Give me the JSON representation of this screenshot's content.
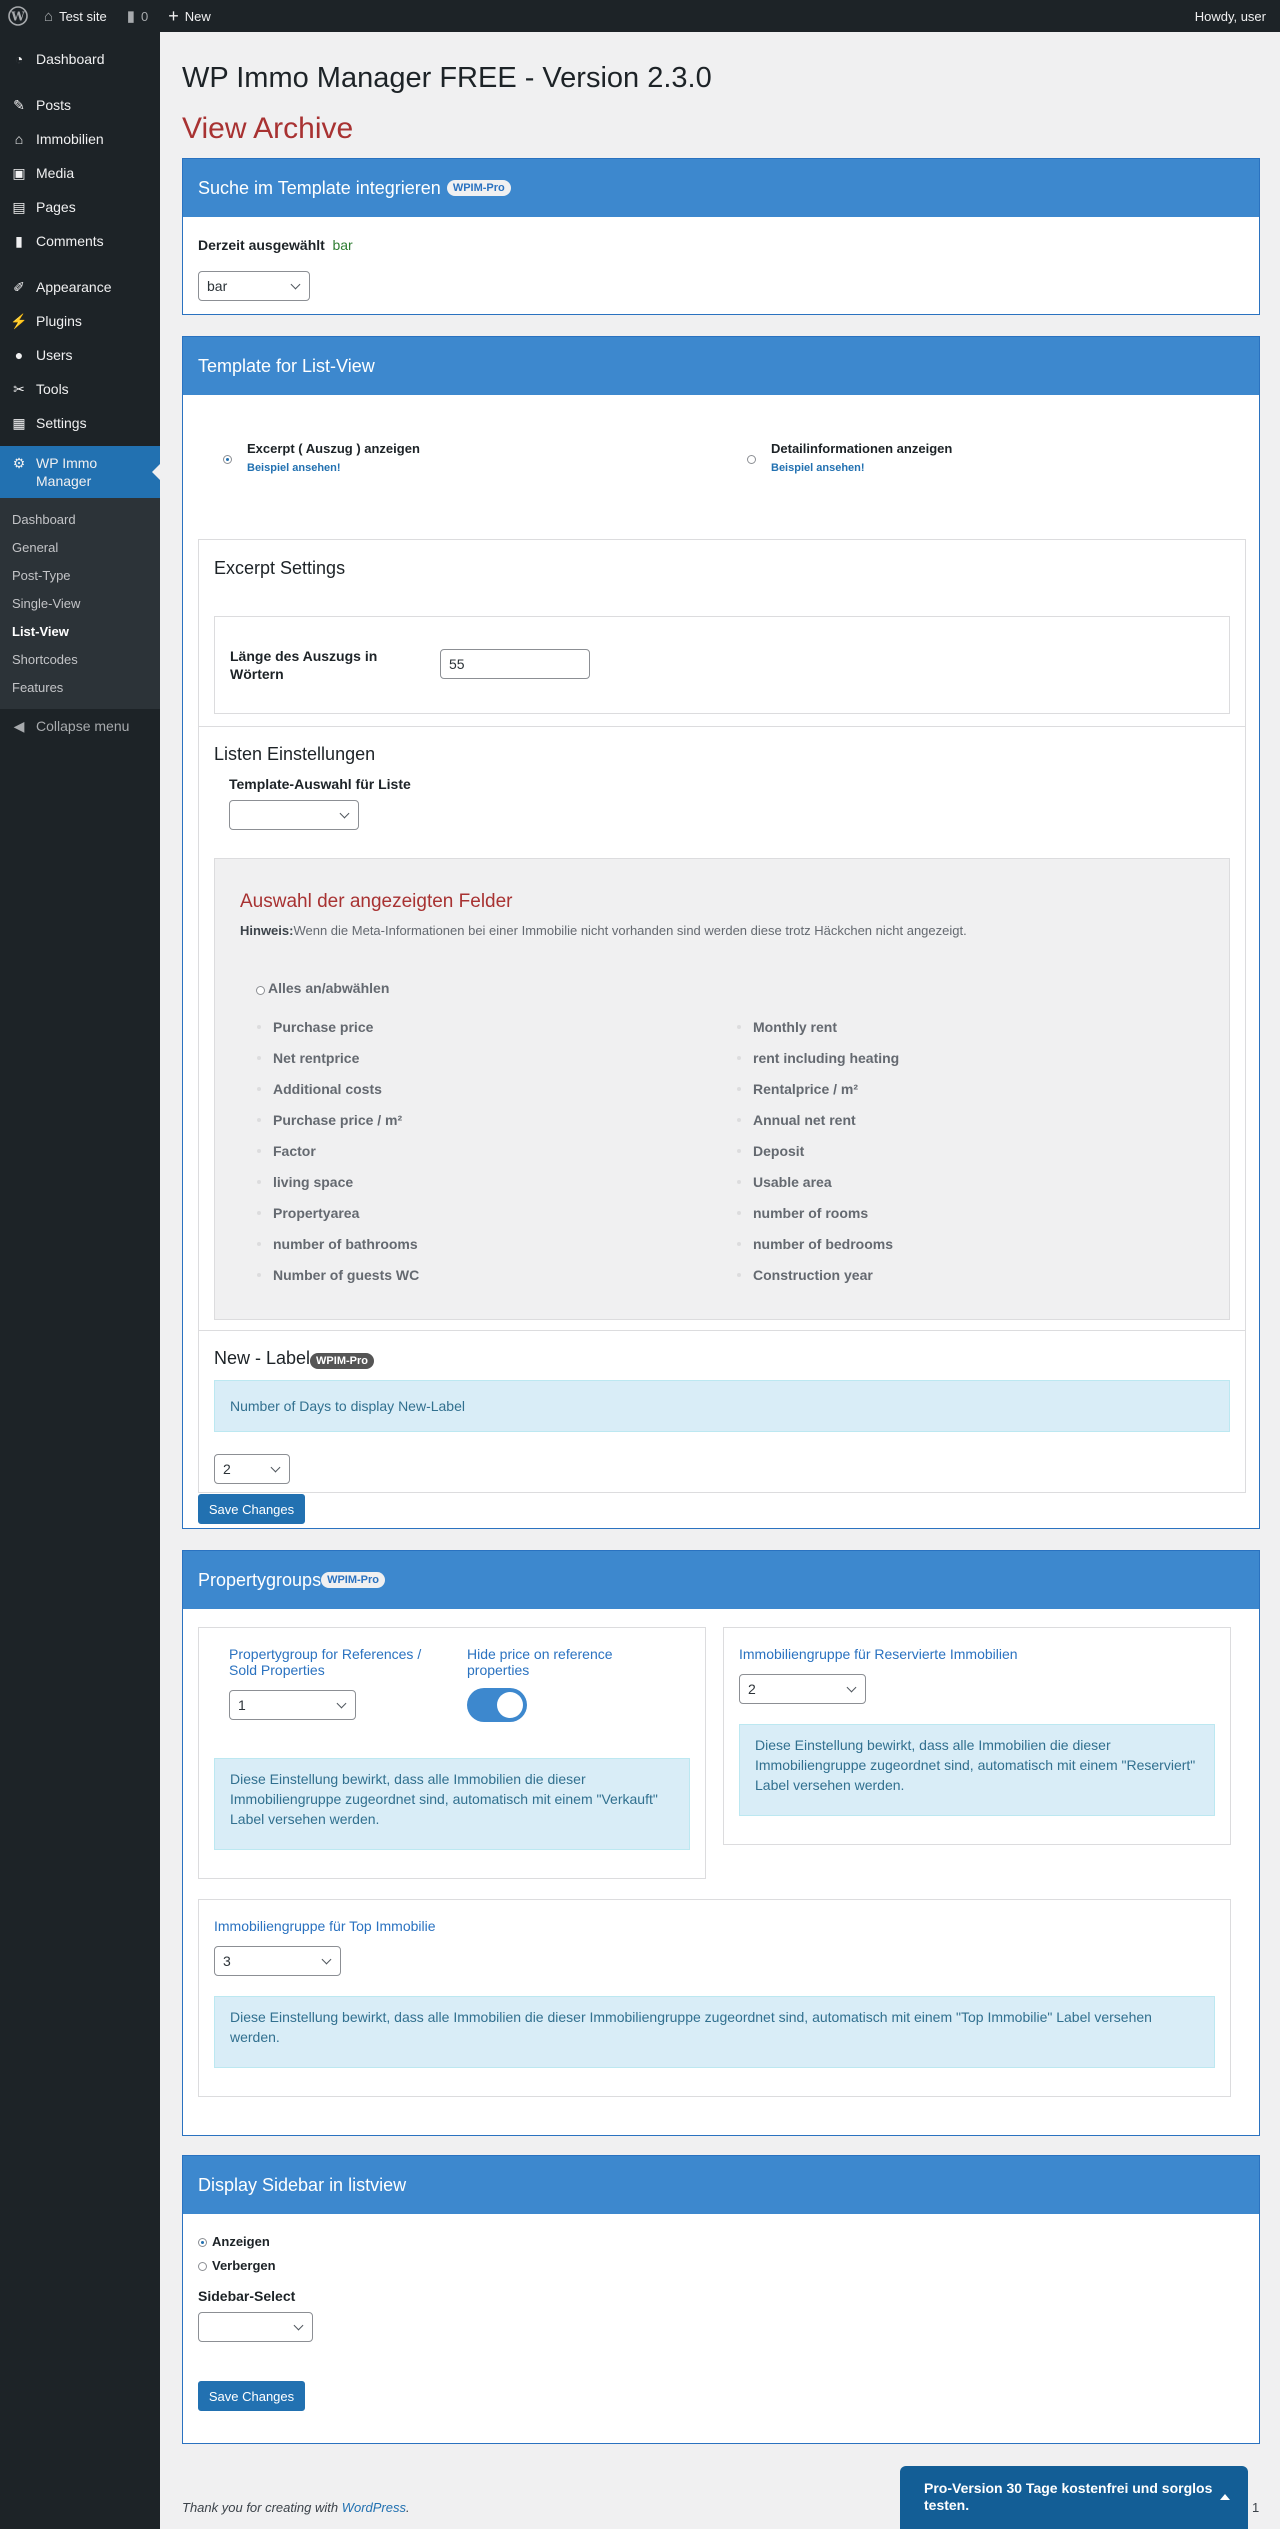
{
  "adminbar": {
    "site": "Test site",
    "comments": "0",
    "new": "New",
    "howdy": "Howdy, user"
  },
  "menu": {
    "items": [
      "Dashboard",
      "Posts",
      "Immobilien",
      "Media",
      "Pages",
      "Comments",
      "Appearance",
      "Plugins",
      "Users",
      "Tools",
      "Settings"
    ],
    "active": "WP Immo Manager",
    "sub": [
      "Dashboard",
      "General",
      "Post-Type",
      "Single-View",
      "List-View",
      "Shortcodes",
      "Features"
    ],
    "collapse": "Collapse menu"
  },
  "page": {
    "title": "WP Immo Manager FREE - Version 2.3.0",
    "subtitle": "View Archive"
  },
  "search_box": {
    "title": "Suche im Template integrieren",
    "badge": "WPIM-Pro",
    "current_label": "Derzeit ausgewählt",
    "current_value": "bar",
    "select_value": "bar"
  },
  "list_template": {
    "title": "Template for List-View",
    "opt1": "Excerpt ( Auszug ) anzeigen",
    "opt1_link": "Beispiel ansehen!",
    "opt2": "Detailinformationen anzeigen",
    "opt2_link": "Beispiel ansehen!",
    "excerpt_title": "Excerpt Settings",
    "excerpt_len_label": "Länge des Auszugs in Wörtern",
    "excerpt_len_value": "55",
    "list_title": "Listen Einstellungen",
    "template_select_label": "Template-Auswahl für Liste",
    "fields_title": "Auswahl der angezeigten Felder",
    "hint_label": "Hinweis:",
    "hint_text": "Wenn die Meta-Informationen bei einer Immobilie nicht vorhanden sind werden diese trotz Häckchen nicht angezeigt.",
    "select_all": "Alles an/abwählen",
    "fields_left": [
      "Purchase price",
      "Net rentprice",
      "Additional costs",
      "Purchase price / m²",
      "Factor",
      "living space",
      "Propertyarea",
      "number of bathrooms",
      "Number of guests WC"
    ],
    "fields_right": [
      "Monthly rent",
      "rent including heating",
      "Rentalprice / m²",
      "Annual net rent",
      "Deposit",
      "Usable area",
      "number of rooms",
      "number of bedrooms",
      "Construction year"
    ],
    "newlabel_title": "New - Label",
    "newlabel_badge": "WPIM-Pro",
    "newlabel_info": "Number of Days to display New-Label",
    "newlabel_value": "2",
    "save": "Save Changes"
  },
  "propertygroups": {
    "title": "Propertygroups",
    "badge": "WPIM-Pro",
    "ref_label": "Propertygroup for References / Sold Properties",
    "ref_value": "1",
    "hide_label": "Hide price on reference properties",
    "ref_info": "Diese Einstellung bewirkt, dass alle Immobilien die dieser Immobiliengruppe zugeordnet sind, automatisch mit einem \"Verkauft\" Label versehen werden.",
    "res_label": "Immobiliengruppe für Reservierte Immobilien",
    "res_value": "2",
    "res_info": "Diese Einstellung bewirkt, dass alle Immobilien die dieser Immobiliengruppe zugeordnet sind, automatisch mit einem \"Reserviert\" Label versehen werden.",
    "top_label": "Immobiliengruppe für Top Immobilie",
    "top_value": "3",
    "top_info": "Diese Einstellung bewirkt, dass alle Immobilien die dieser Immobiliengruppe zugeordnet sind, automatisch mit einem \"Top Immobilie\" Label versehen werden."
  },
  "sidebar_box": {
    "title": "Display Sidebar in listview",
    "show": "Anzeigen",
    "hide": "Verbergen",
    "select_label": "Sidebar-Select",
    "save": "Save Changes"
  },
  "footer": {
    "text": "Thank you for creating with ",
    "link": "WordPress",
    "after": ".",
    "version": "1"
  },
  "promo": {
    "text": "Pro-Version 30 Tage kostenfrei und sorglos testen."
  }
}
